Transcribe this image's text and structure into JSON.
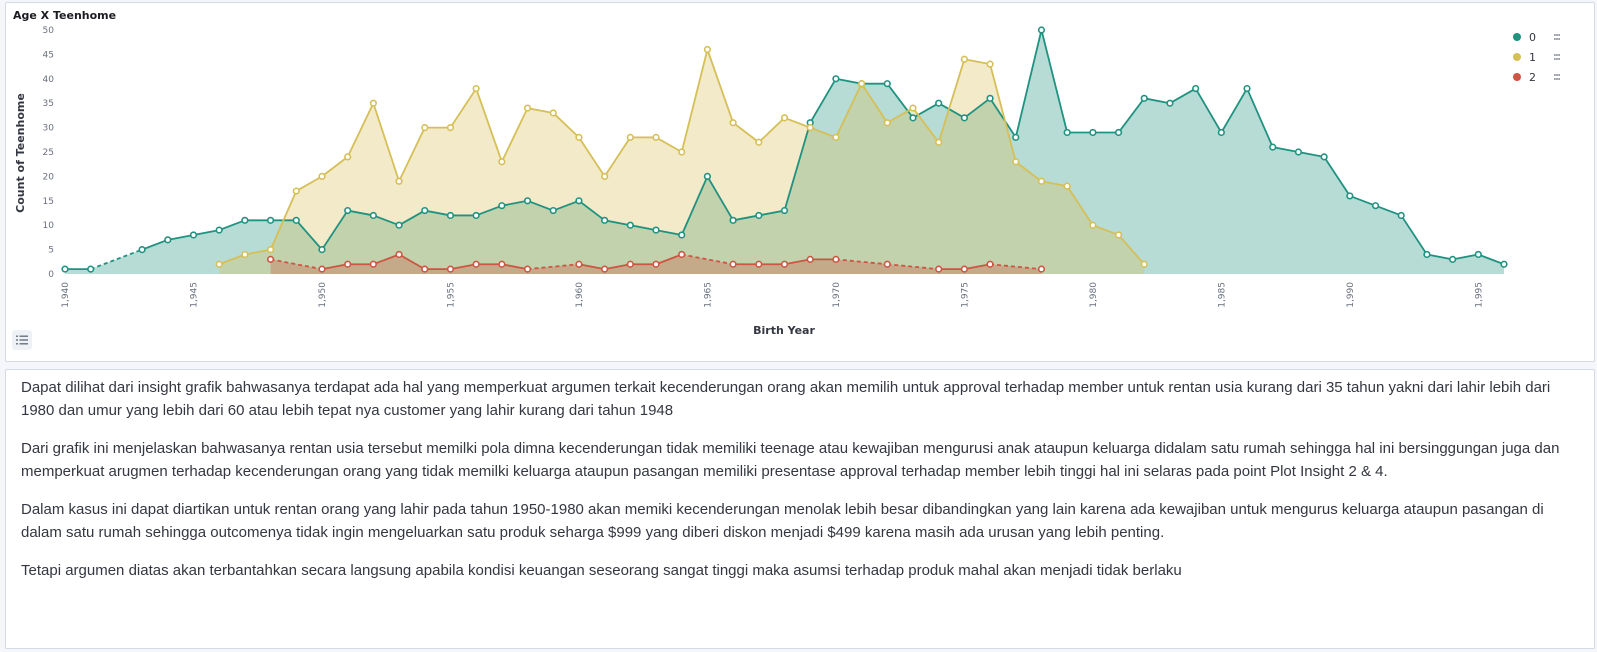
{
  "panel": {
    "title": "Age X Teenhome",
    "legend_toggle_icon": "list-icon"
  },
  "chart_data": {
    "type": "area",
    "title": "Age X Teenhome",
    "xlabel": "Birth Year",
    "ylabel": "Count of Teenhome",
    "xlim": [
      1940,
      1996
    ],
    "ylim": [
      0,
      50
    ],
    "x_ticks": [
      "1,940",
      "1,945",
      "1,950",
      "1,955",
      "1,960",
      "1,965",
      "1,970",
      "1,975",
      "1,980",
      "1,985",
      "1,990",
      "1,995"
    ],
    "y_ticks": [
      "0",
      "5",
      "10",
      "15",
      "20",
      "25",
      "30",
      "35",
      "40",
      "45",
      "50"
    ],
    "grid": false,
    "legend_position": "top-right",
    "series": [
      {
        "name": "0",
        "color": "#209280",
        "points": [
          [
            1940,
            1
          ],
          [
            1941,
            1
          ],
          [
            1943,
            5
          ],
          [
            1944,
            7
          ],
          [
            1945,
            8
          ],
          [
            1946,
            9
          ],
          [
            1947,
            11
          ],
          [
            1948,
            11
          ],
          [
            1949,
            11
          ],
          [
            1950,
            5
          ],
          [
            1951,
            13
          ],
          [
            1952,
            12
          ],
          [
            1953,
            10
          ],
          [
            1954,
            13
          ],
          [
            1955,
            12
          ],
          [
            1956,
            12
          ],
          [
            1957,
            14
          ],
          [
            1958,
            15
          ],
          [
            1959,
            13
          ],
          [
            1960,
            15
          ],
          [
            1961,
            11
          ],
          [
            1962,
            10
          ],
          [
            1963,
            9
          ],
          [
            1964,
            8
          ],
          [
            1965,
            20
          ],
          [
            1966,
            11
          ],
          [
            1967,
            12
          ],
          [
            1968,
            13
          ],
          [
            1969,
            31
          ],
          [
            1970,
            40
          ],
          [
            1971,
            39
          ],
          [
            1972,
            39
          ],
          [
            1973,
            32
          ],
          [
            1974,
            35
          ],
          [
            1975,
            32
          ],
          [
            1976,
            36
          ],
          [
            1977,
            28
          ],
          [
            1978,
            50
          ],
          [
            1979,
            29
          ],
          [
            1980,
            29
          ],
          [
            1981,
            29
          ],
          [
            1982,
            36
          ],
          [
            1983,
            35
          ],
          [
            1984,
            38
          ],
          [
            1985,
            29
          ],
          [
            1986,
            38
          ],
          [
            1987,
            26
          ],
          [
            1988,
            25
          ],
          [
            1989,
            24
          ],
          [
            1990,
            16
          ],
          [
            1991,
            14
          ],
          [
            1992,
            12
          ],
          [
            1993,
            4
          ],
          [
            1994,
            3
          ],
          [
            1995,
            4
          ],
          [
            1996,
            2
          ]
        ]
      },
      {
        "name": "1",
        "color": "#d6bf57",
        "points": [
          [
            1946,
            2
          ],
          [
            1947,
            4
          ],
          [
            1948,
            5
          ],
          [
            1949,
            17
          ],
          [
            1950,
            20
          ],
          [
            1951,
            24
          ],
          [
            1952,
            35
          ],
          [
            1953,
            19
          ],
          [
            1954,
            30
          ],
          [
            1955,
            30
          ],
          [
            1956,
            38
          ],
          [
            1957,
            23
          ],
          [
            1958,
            34
          ],
          [
            1959,
            33
          ],
          [
            1960,
            28
          ],
          [
            1961,
            20
          ],
          [
            1962,
            28
          ],
          [
            1963,
            28
          ],
          [
            1964,
            25
          ],
          [
            1965,
            46
          ],
          [
            1966,
            31
          ],
          [
            1967,
            27
          ],
          [
            1968,
            32
          ],
          [
            1969,
            30
          ],
          [
            1970,
            28
          ],
          [
            1971,
            39
          ],
          [
            1972,
            31
          ],
          [
            1973,
            34
          ],
          [
            1974,
            27
          ],
          [
            1975,
            44
          ],
          [
            1976,
            43
          ],
          [
            1977,
            23
          ],
          [
            1978,
            19
          ],
          [
            1979,
            18
          ],
          [
            1980,
            10
          ],
          [
            1981,
            8
          ],
          [
            1982,
            2
          ]
        ]
      },
      {
        "name": "2",
        "color": "#cc5642",
        "points": [
          [
            1948,
            3
          ],
          [
            1950,
            1
          ],
          [
            1951,
            2
          ],
          [
            1952,
            2
          ],
          [
            1953,
            4
          ],
          [
            1954,
            1
          ],
          [
            1955,
            1
          ],
          [
            1956,
            2
          ],
          [
            1957,
            2
          ],
          [
            1958,
            1
          ],
          [
            1960,
            2
          ],
          [
            1961,
            1
          ],
          [
            1962,
            2
          ],
          [
            1963,
            2
          ],
          [
            1964,
            4
          ],
          [
            1966,
            2
          ],
          [
            1967,
            2
          ],
          [
            1968,
            2
          ],
          [
            1969,
            3
          ],
          [
            1970,
            3
          ],
          [
            1972,
            2
          ],
          [
            1974,
            1
          ],
          [
            1975,
            1
          ],
          [
            1976,
            2
          ],
          [
            1978,
            1
          ]
        ]
      }
    ]
  },
  "markdown": {
    "paragraphs": [
      "Dapat dilihat dari insight grafik bahwasanya terdapat ada hal yang memperkuat argumen terkait kecenderungan orang akan memilih untuk approval terhadap member untuk rentan usia kurang dari 35 tahun yakni dari lahir lebih dari 1980 dan umur yang lebih dari 60 atau lebih tepat nya customer yang lahir kurang dari tahun 1948",
      "Dari grafik ini menjelaskan bahwasanya rentan usia tersebut memilki pola dimna kecenderungan tidak memiliki teenage atau kewajiban mengurusi anak ataupun keluarga didalam satu rumah sehingga hal ini bersinggungan juga dan memperkuat arugmen terhadap kecenderungan orang yang tidak memilki keluarga ataupun pasangan memiliki presentase approval terhadap member lebih tinggi hal ini selaras pada point Plot Insight 2 & 4.",
      "Dalam kasus ini dapat diartikan untuk rentan orang yang lahir pada tahun 1950-1980 akan memiki kecenderungan menolak lebih besar dibandingkan yang lain karena ada kewajiban untuk mengurus keluarga ataupun pasangan di dalam satu rumah sehingga outcomenya tidak ingin mengeluarkan satu produk seharga $999 yang diberi diskon menjadi $499 karena masih ada urusan yang lebih penting.",
      "Tetapi argumen diatas akan terbantahkan secara langsung apabila kondisi keuangan seseorang sangat tinggi maka asumsi terhadap produk mahal akan menjadi tidak berlaku"
    ]
  }
}
